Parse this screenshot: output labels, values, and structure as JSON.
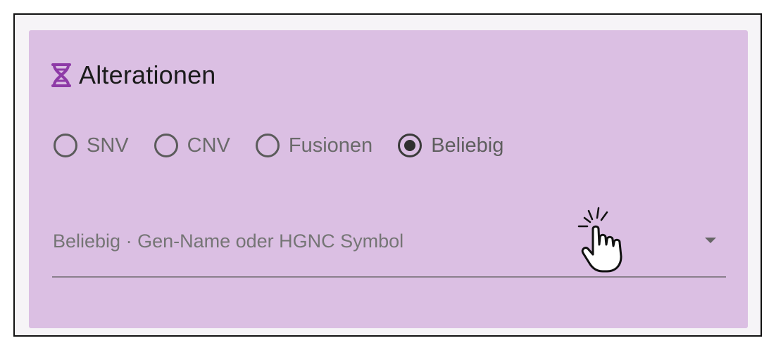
{
  "section": {
    "title": "Alterationen",
    "icon": "dna-icon",
    "accent_color": "#8e3aa7",
    "background_color": "#dbbfe3"
  },
  "alteration_type": {
    "options": [
      {
        "label": "SNV",
        "selected": false
      },
      {
        "label": "CNV",
        "selected": false
      },
      {
        "label": "Fusionen",
        "selected": false
      },
      {
        "label": "Beliebig",
        "selected": true
      }
    ]
  },
  "gene_select": {
    "placeholder": "Beliebig · Gen-Name oder HGNC Symbol",
    "icon": "chevron-down-icon"
  },
  "cursor": {
    "icon": "hand-pointer-click-icon"
  }
}
